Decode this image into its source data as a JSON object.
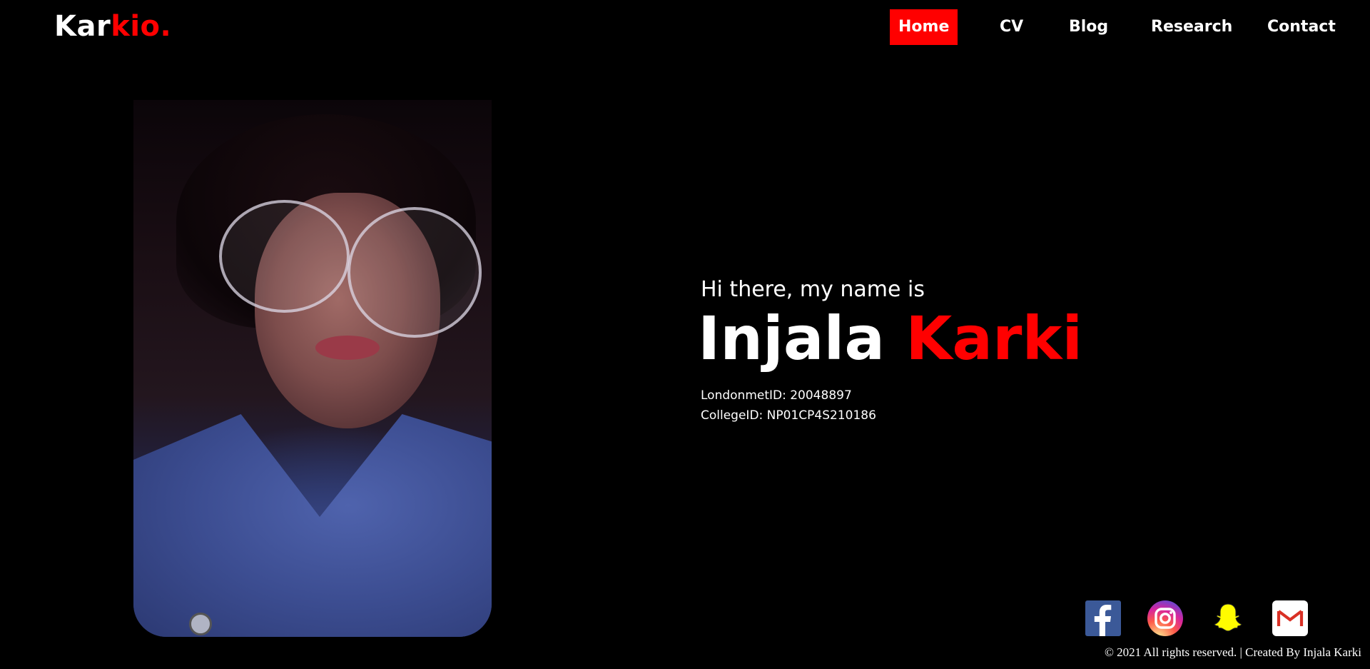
{
  "logo": {
    "part1": "Kar",
    "part2": "kio."
  },
  "nav": {
    "items": [
      {
        "label": "Home",
        "active": true
      },
      {
        "label": "CV",
        "active": false
      },
      {
        "label": "Blog",
        "active": false
      },
      {
        "label": "Research",
        "active": false
      },
      {
        "label": "Contact",
        "active": false
      }
    ]
  },
  "hero": {
    "greeting": "Hi there, my name is",
    "first_name": "Injala",
    "last_name": "Karki",
    "london_met_id": "LondonmetID: 20048897",
    "college_id": "CollegeID: NP01CP4S210186"
  },
  "social": [
    {
      "icon": "facebook-icon"
    },
    {
      "icon": "instagram-icon"
    },
    {
      "icon": "snapchat-icon"
    },
    {
      "icon": "gmail-icon"
    }
  ],
  "footer": {
    "text": "© 2021 All rights reserved. | Created By Injala Karki"
  },
  "colors": {
    "accent": "#ff0000",
    "background": "#000000",
    "text": "#ffffff"
  }
}
